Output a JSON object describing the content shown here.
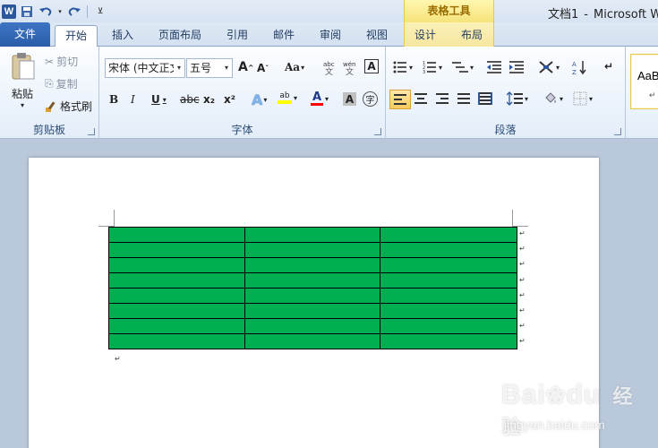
{
  "window": {
    "doc_name": "文档1",
    "separator": "-",
    "app_name": "Microsoft Wo",
    "contextual_tab_group": "表格工具"
  },
  "quick_access": {
    "app_icon_letter": "W",
    "icons": [
      "save-icon",
      "undo-icon",
      "redo-icon",
      "customize-icon"
    ]
  },
  "tabs": [
    {
      "label": "文件"
    },
    {
      "label": "开始"
    },
    {
      "label": "插入"
    },
    {
      "label": "页面布局"
    },
    {
      "label": "引用"
    },
    {
      "label": "邮件"
    },
    {
      "label": "审阅"
    },
    {
      "label": "视图"
    },
    {
      "label": "设计"
    },
    {
      "label": "布局"
    }
  ],
  "active_tab": "开始",
  "ribbon": {
    "clipboard": {
      "paste": "粘贴",
      "cut": "剪切",
      "copy": "复制",
      "format_painter": "格式刷",
      "group_label": "剪贴板"
    },
    "font": {
      "font_name": "宋体 (中文正文",
      "font_size": "五号",
      "bold": "B",
      "italic": "I",
      "underline": "U",
      "strike": "abc",
      "subscript": "x₂",
      "superscript": "x²",
      "change_case": "Aa",
      "grow": "A",
      "shrink": "A",
      "group_label": "字体"
    },
    "paragraph": {
      "group_label": "段落"
    },
    "styles": {
      "sample": "AaB"
    }
  },
  "table": {
    "columns": 3,
    "rows": 8
  },
  "watermark": {
    "brand": "Bai",
    "brand2": "du",
    "sub": "经验",
    "url": "jingyan.baidu.com"
  },
  "colors": {
    "table_fill": "#00b050",
    "file_tab": "#2b5da8",
    "accent_font_red": "#ff0000"
  }
}
